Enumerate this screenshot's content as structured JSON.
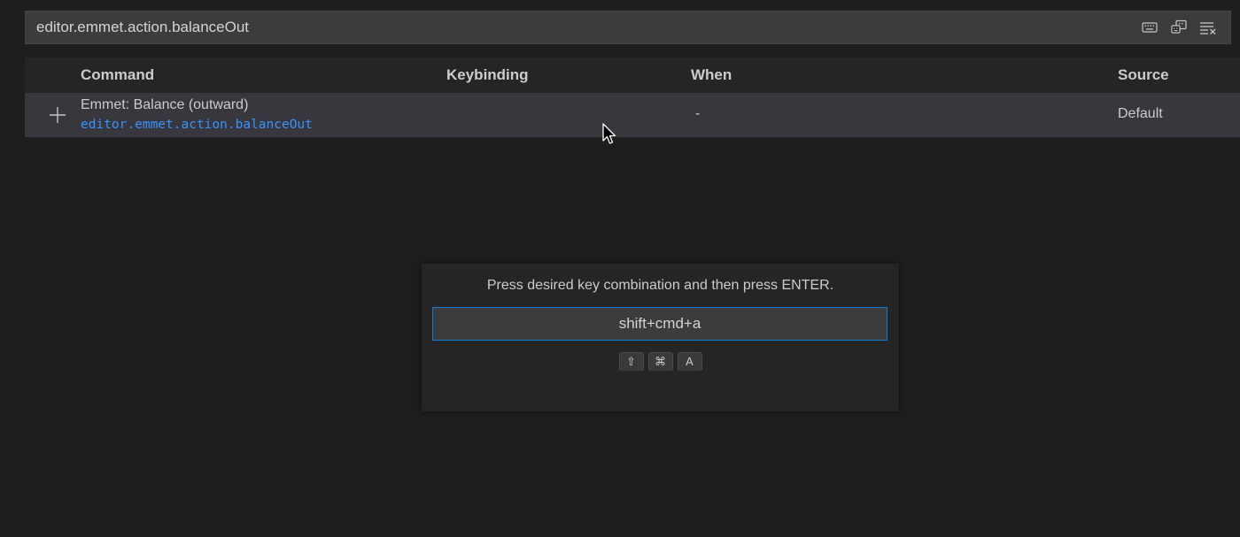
{
  "search": {
    "value": "editor.emmet.action.balanceOut",
    "actions": [
      {
        "icon": "keyboard-icon"
      },
      {
        "icon": "record-keys-icon"
      },
      {
        "icon": "clear-filter-icon"
      }
    ]
  },
  "table": {
    "headers": {
      "command": "Command",
      "keybinding": "Keybinding",
      "when": "When",
      "source": "Source"
    },
    "rows": [
      {
        "command_title": "Emmet: Balance (outward)",
        "command_id": "editor.emmet.action.balanceOut",
        "keybinding": "",
        "when": "-",
        "source": "Default"
      }
    ]
  },
  "dialog": {
    "message": "Press desired key combination and then press ENTER.",
    "input_value": "shift+cmd+a",
    "keys": [
      "⇧",
      "⌘",
      "A"
    ]
  },
  "colors": {
    "background": "#1e1e1e",
    "selected_row": "#37373d",
    "link_blue": "#3794ff",
    "focus_border": "#0e7bd6"
  }
}
